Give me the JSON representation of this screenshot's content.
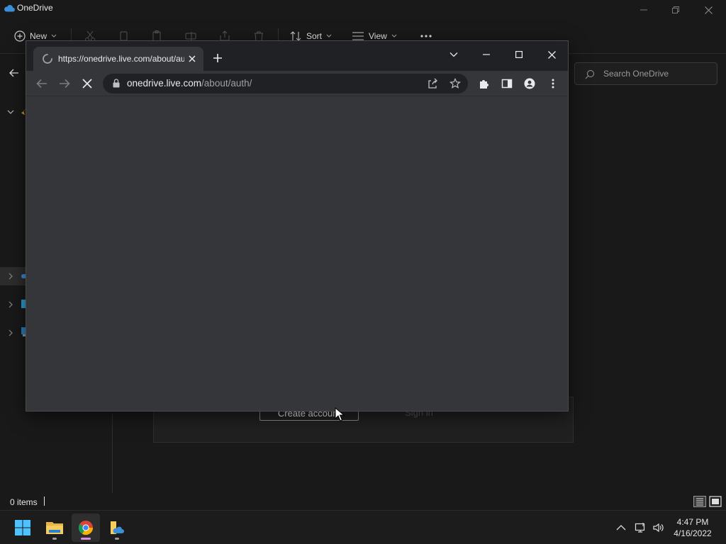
{
  "explorer": {
    "title": "OneDrive",
    "toolbar": {
      "new_label": "New",
      "sort_label": "Sort",
      "view_label": "View"
    },
    "search_placeholder": "Search OneDrive",
    "status_text": "0 items"
  },
  "dialog": {
    "create_account_label": "Create account",
    "sign_in_label": "Sign in"
  },
  "chrome": {
    "tab_title": "https://onedrive.live.com/about/auth/",
    "url_host": "onedrive.live.com",
    "url_path": "/about/auth/"
  },
  "taskbar": {
    "time": "4:47 PM",
    "date": "4/16/2022"
  },
  "colors": {
    "chrome_frame": "#202124",
    "chrome_body": "#35363a",
    "explorer_bg": "#191919",
    "onedrive_blue": "#3b8ed8"
  }
}
